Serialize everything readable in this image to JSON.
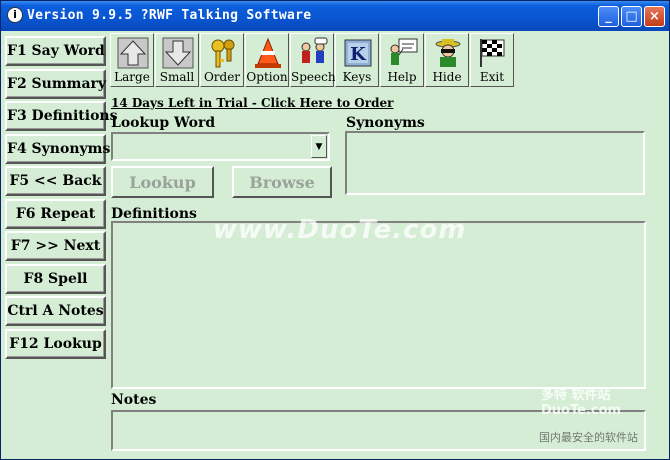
{
  "window": {
    "title": "Version 9.9.5 ?RWF Talking Software",
    "app_icon_glyph": "i",
    "controls": {
      "minimize": "_",
      "maximize": "□",
      "close": "×"
    }
  },
  "function_keys": [
    {
      "label": "F1 Say Word"
    },
    {
      "label": "F2 Summary"
    },
    {
      "label": "F3 Definitions"
    },
    {
      "label": "F4 Synonyms"
    },
    {
      "label": "F5 << Back"
    },
    {
      "label": "F6 Repeat"
    },
    {
      "label": "F7 >> Next"
    },
    {
      "label": "F8 Spell"
    },
    {
      "label": "Ctrl A Notes"
    },
    {
      "label": "F12 Lookup"
    }
  ],
  "toolbar": [
    {
      "label": "Large",
      "icon": "arrow-up-icon"
    },
    {
      "label": "Small",
      "icon": "arrow-down-icon"
    },
    {
      "label": "Order",
      "icon": "keys-icon"
    },
    {
      "label": "Option",
      "icon": "cone-icon"
    },
    {
      "label": "Speech",
      "icon": "speech-people-icon"
    },
    {
      "label": "Keys",
      "icon": "k-key-icon"
    },
    {
      "label": "Help",
      "icon": "help-presenter-icon"
    },
    {
      "label": "Hide",
      "icon": "hide-spy-icon"
    },
    {
      "label": "Exit",
      "icon": "checkered-flag-icon"
    }
  ],
  "trial_link": "14 Days Left in Trial - Click Here to Order",
  "lookup": {
    "label": "Lookup Word",
    "value": "",
    "lookup_button": "Lookup",
    "browse_button": "Browse"
  },
  "synonyms": {
    "label": "Synonyms"
  },
  "definitions": {
    "label": "Definitions"
  },
  "notes": {
    "label": "Notes"
  },
  "watermarks": {
    "main": "www.DuoTe.com",
    "badge": "多特 软件站",
    "badge_sub": "DuoTe.com",
    "footer": "国内最安全的软件站"
  },
  "colors": {
    "window_bg": "#d4edd4",
    "title_bar": "#0a55d0"
  }
}
